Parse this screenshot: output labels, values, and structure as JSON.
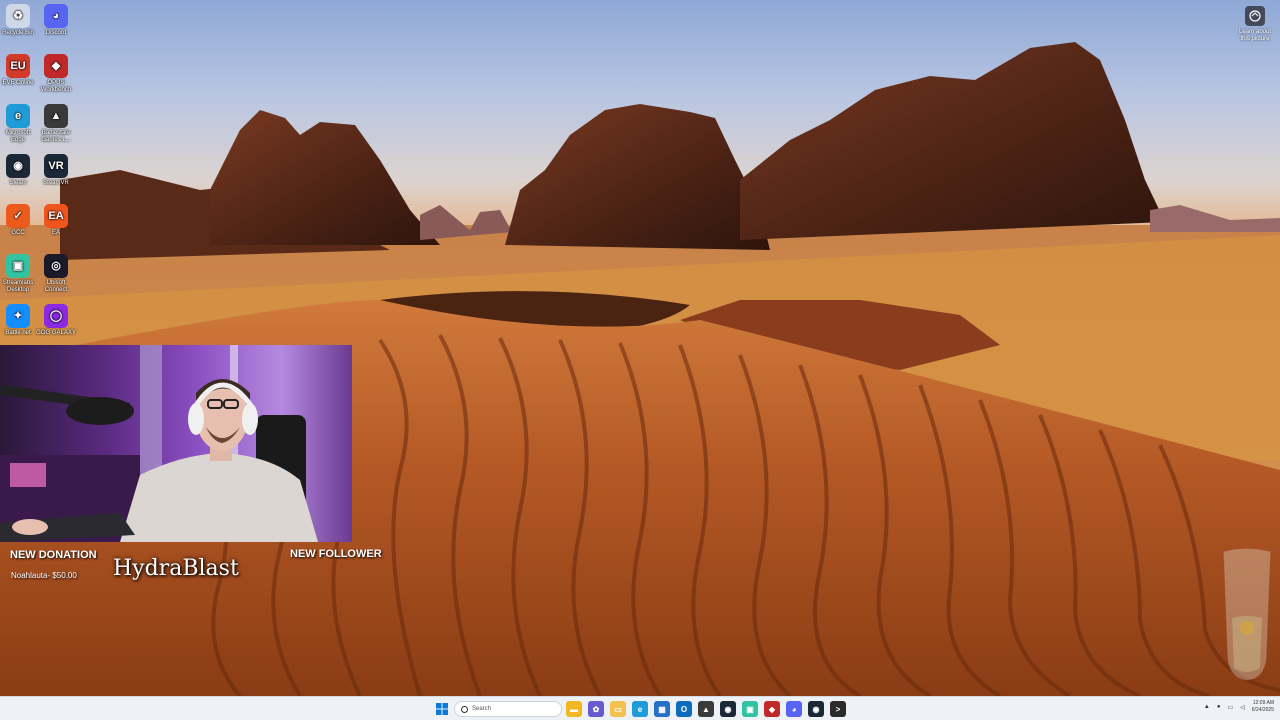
{
  "desktop": {
    "icons": [
      {
        "label": "Recycle Bin",
        "icon": "recycle-bin-icon",
        "color": "#cfd8e8",
        "glyph": "♻"
      },
      {
        "label": "Discord",
        "icon": "discord-icon",
        "color": "#5865f2",
        "glyph": "◕"
      },
      {
        "label": "EVE Online",
        "icon": "eve-online-icon",
        "color": "#d23a2a",
        "glyph": "EU"
      },
      {
        "label": "OPUS Workbench",
        "icon": "opus-icon",
        "color": "#c0282a",
        "glyph": "◆"
      },
      {
        "label": "Microsoft Edge",
        "icon": "edge-icon",
        "color": "#1f9cd8",
        "glyph": "e"
      },
      {
        "label": "Battlestate Games L...",
        "icon": "battlestate-icon",
        "color": "#3a3a3a",
        "glyph": "▲"
      },
      {
        "label": "Steam",
        "icon": "steam-icon",
        "color": "#1b2838",
        "glyph": "◉"
      },
      {
        "label": "SteamVR",
        "icon": "steamvr-icon",
        "color": "#1b2838",
        "glyph": "VR"
      },
      {
        "label": "GCC",
        "icon": "gcc-icon",
        "color": "#ea5b1c",
        "glyph": "✓"
      },
      {
        "label": "EA",
        "icon": "ea-icon",
        "color": "#f0551e",
        "glyph": "EA"
      },
      {
        "label": "Streamlabs Desktop",
        "icon": "streamlabs-icon",
        "color": "#31c3a2",
        "glyph": "▣"
      },
      {
        "label": "Ubisoft Connect",
        "icon": "ubisoft-icon",
        "color": "#1a1a2a",
        "glyph": "◎"
      },
      {
        "label": "Battle.net",
        "icon": "battlenet-icon",
        "color": "#148eff",
        "glyph": "✦"
      },
      {
        "label": "GOG GALAXY",
        "icon": "gog-icon",
        "color": "#8a2be2",
        "glyph": "◯"
      }
    ],
    "learn_label": "Learn about this picture"
  },
  "overlay": {
    "donation_title": "NEW DONATION",
    "donation_value": "Noahlauta- $50.00",
    "follower_title": "NEW FOLLOWER",
    "follower_name": "HydraBlast"
  },
  "taskbar": {
    "search_placeholder": "Search",
    "apps": [
      {
        "name": "file-explorer-icon",
        "color": "#f2b824",
        "glyph": "▬"
      },
      {
        "name": "copilot-icon",
        "color": "#6a5acd",
        "glyph": "✿"
      },
      {
        "name": "folder-icon",
        "color": "#f2c14e",
        "glyph": "▭"
      },
      {
        "name": "edge-icon",
        "color": "#1f9cd8",
        "glyph": "e"
      },
      {
        "name": "store-icon",
        "color": "#2670c8",
        "glyph": "▦"
      },
      {
        "name": "outlook-icon",
        "color": "#0f6cbd",
        "glyph": "O"
      },
      {
        "name": "battlestate-icon",
        "color": "#3a3a3a",
        "glyph": "▲"
      },
      {
        "name": "steam-icon",
        "color": "#1b2838",
        "glyph": "◉"
      },
      {
        "name": "streamlabs-icon",
        "color": "#31c3a2",
        "glyph": "▣"
      },
      {
        "name": "opus-icon",
        "color": "#c0282a",
        "glyph": "◆"
      },
      {
        "name": "discord-icon",
        "color": "#5865f2",
        "glyph": "◕"
      },
      {
        "name": "steamvr-icon",
        "color": "#1b2838",
        "glyph": "◉"
      },
      {
        "name": "terminal-icon",
        "color": "#2b2b2b",
        "glyph": ">"
      }
    ],
    "clock_time": "12:09 AM",
    "clock_date": "6/24/2025"
  }
}
